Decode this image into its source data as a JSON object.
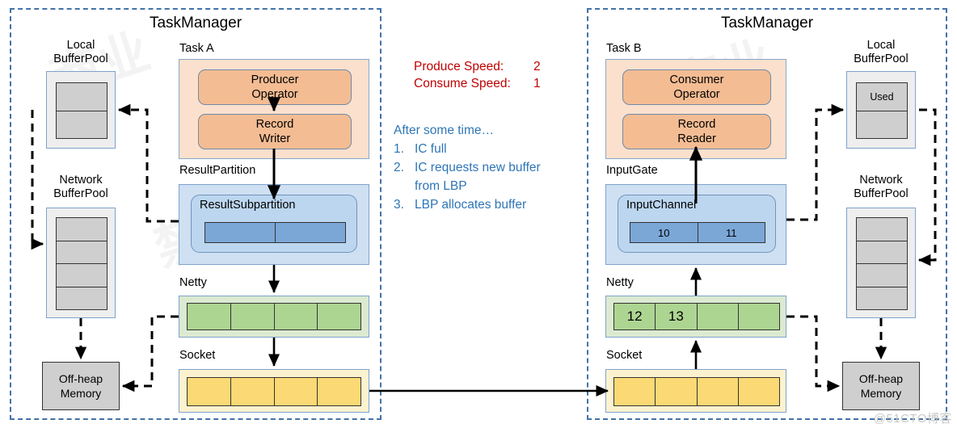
{
  "left_tm": {
    "title": "TaskManager",
    "local_pool": {
      "label_line1": "Local",
      "label_line2": "BufferPool",
      "slots": [
        "",
        ""
      ]
    },
    "network_pool": {
      "label_line1": "Network",
      "label_line2": "BufferPool",
      "slots": [
        "",
        "",
        "",
        ""
      ]
    },
    "offheap": {
      "line1": "Off-heap",
      "line2": "Memory"
    },
    "task": {
      "label": "Task A",
      "operator": {
        "line1": "Producer",
        "line2": "Operator"
      },
      "record": {
        "line1": "Record",
        "line2": "Writer"
      }
    },
    "partition": {
      "label": "ResultPartition",
      "sub_title": "ResultSubpartition",
      "cells": [
        "",
        ""
      ]
    },
    "netty": {
      "label": "Netty",
      "cells": [
        "",
        "",
        "",
        ""
      ]
    },
    "socket": {
      "label": "Socket",
      "cells": [
        "",
        "",
        "",
        ""
      ]
    }
  },
  "right_tm": {
    "title": "TaskManager",
    "local_pool": {
      "label_line1": "Local",
      "label_line2": "BufferPool",
      "slots": [
        "Used",
        ""
      ]
    },
    "network_pool": {
      "label_line1": "Network",
      "label_line2": "BufferPool",
      "slots": [
        "",
        "",
        "",
        ""
      ]
    },
    "offheap": {
      "line1": "Off-heap",
      "line2": "Memory"
    },
    "task": {
      "label": "Task B",
      "operator": {
        "line1": "Consumer",
        "line2": "Operator"
      },
      "record": {
        "line1": "Record",
        "line2": "Reader"
      }
    },
    "gate": {
      "label": "InputGate",
      "sub_title": "InputChannel",
      "cells": [
        "10",
        "11"
      ]
    },
    "netty": {
      "label": "Netty",
      "cells": [
        "12",
        "13",
        "",
        ""
      ]
    },
    "socket": {
      "label": "Socket",
      "cells": [
        "",
        "",
        "",
        ""
      ]
    }
  },
  "annotation": {
    "speed": {
      "produce_label": "Produce Speed:",
      "produce_value": "2",
      "consume_label": "Consume Speed:",
      "consume_value": "1",
      "color": "#c00000"
    },
    "steps": {
      "intro": "After some time…",
      "color": "#2e75b6",
      "items": [
        {
          "num": "1.",
          "text": "IC full"
        },
        {
          "num": "2.",
          "text": "IC requests new buffer"
        },
        {
          "num": "",
          "text": "from LBP"
        },
        {
          "num": "3.",
          "text": "LBP allocates buffer"
        }
      ]
    }
  },
  "watermarks": {
    "cn_1": "商业",
    "cn_2": "禁",
    "cn_3": "商业",
    "credit": "@51CTO博客"
  },
  "colors": {
    "tm_border": "#4472a8",
    "task_fill": "#fbe0cd",
    "operator_fill": "#f4bc93",
    "partition_fill": "#cfe0f3",
    "subpartition_fill": "#bcd6ef",
    "buffer_cell_blue": "#7ba7d7",
    "netty_fill": "#dbead0",
    "netty_cell": "#add592",
    "socket_fill": "#fdf2cf",
    "socket_cell": "#fbd975",
    "pool_fill": "#eeeeee",
    "pool_cell": "#cfcfcf",
    "accent_red": "#c00000",
    "accent_blue": "#2e75b6"
  }
}
